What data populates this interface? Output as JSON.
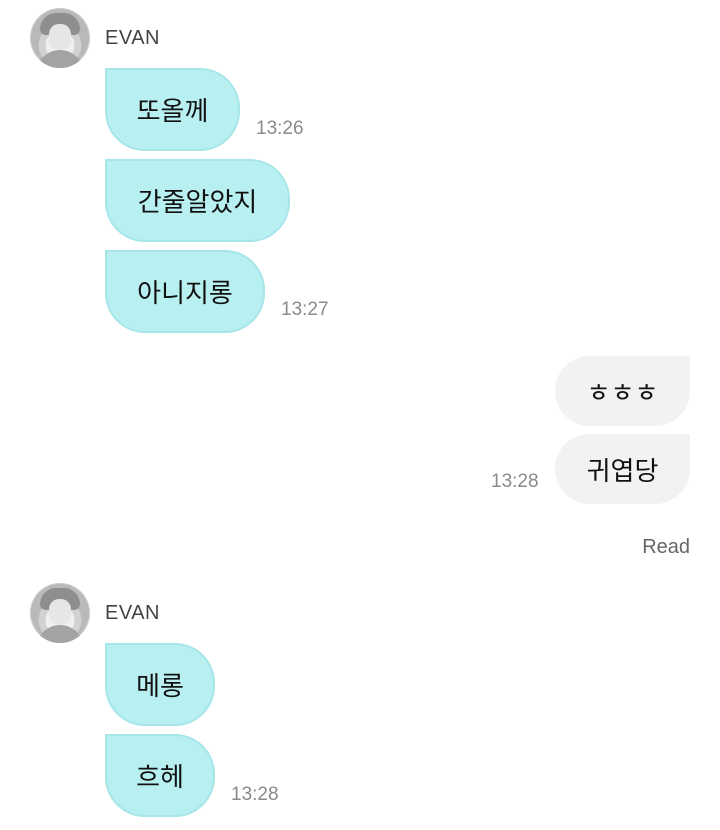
{
  "groups": [
    {
      "sender": "EVAN",
      "messages": [
        {
          "text": "또올께",
          "time": "13:26"
        },
        {
          "text": "간줄알았지",
          "time": ""
        },
        {
          "text": "아니지롱",
          "time": "13:27"
        }
      ]
    },
    {
      "sender": "EVAN",
      "messages": [
        {
          "text": "메롱",
          "time": ""
        },
        {
          "text": "흐헤",
          "time": "13:28"
        }
      ]
    }
  ],
  "outgoing": {
    "messages": [
      {
        "text": "ㅎㅎㅎ",
        "time": ""
      },
      {
        "text": "귀엽당",
        "time": "13:28"
      }
    ],
    "read_label": "Read"
  }
}
